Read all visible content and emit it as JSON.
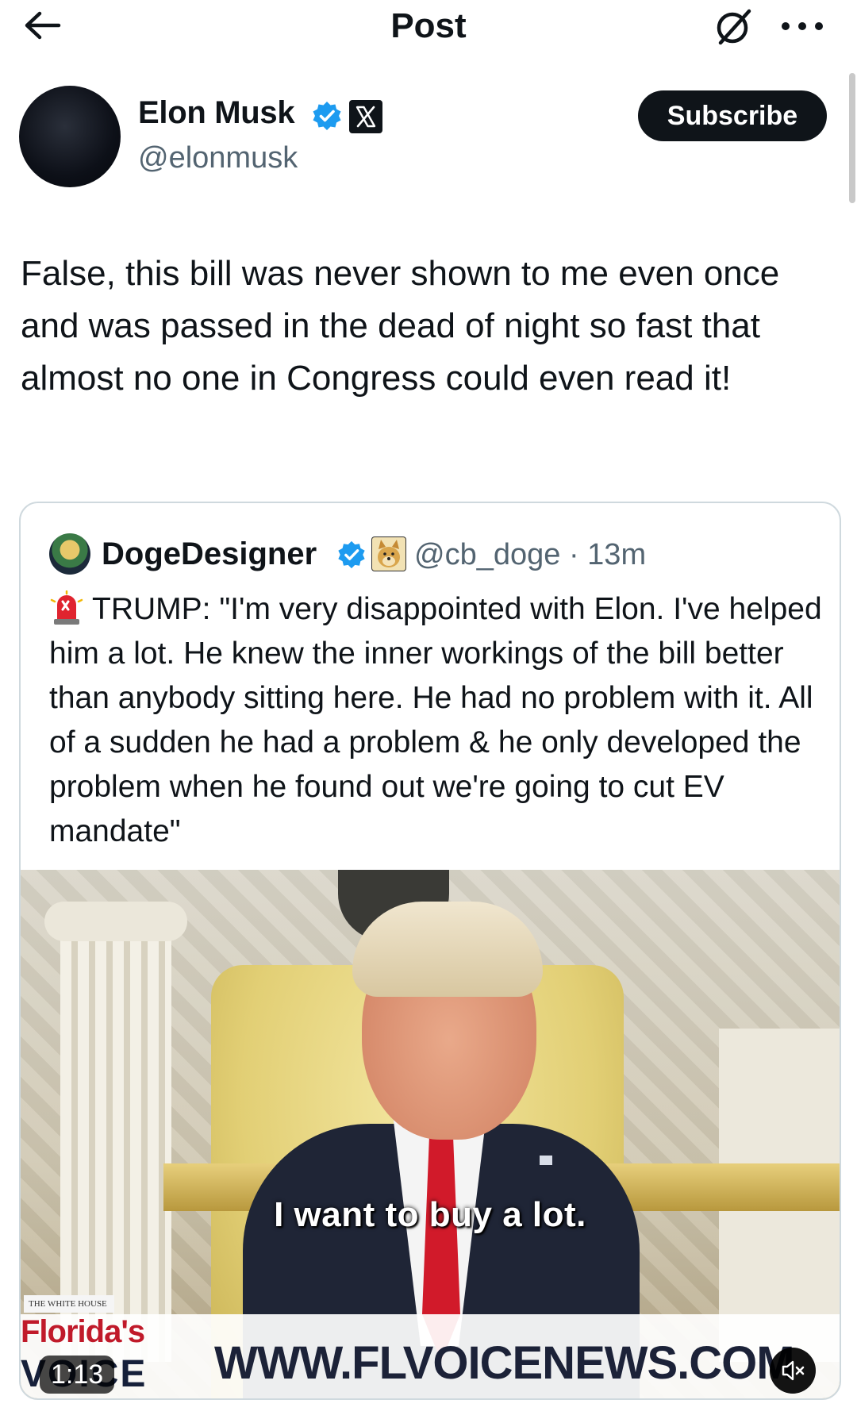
{
  "header": {
    "title": "Post",
    "back_icon": "arrow-left-icon",
    "grok_icon": "grok-icon",
    "more_icon": "more-horizontal-icon"
  },
  "author": {
    "name": "Elon Musk",
    "handle": "@elonmusk",
    "verified": true,
    "affiliation_badge": "x-logo",
    "subscribe_label": "Subscribe"
  },
  "post": {
    "text": "False, this bill was never shown to me even once and was passed in the dead of night so fast that almost no one in Congress could even read it!"
  },
  "quoted_post": {
    "name": "DogeDesigner",
    "handle": "@cb_doge",
    "separator": "·",
    "time": "13m",
    "verified": true,
    "text": "TRUMP: \"I'm very disappointed with Elon. I've helped him a lot. He knew the inner workings of the bill better than anybody sitting here. He had no problem with it. All of a sudden he had a problem & he only developed the problem when he found out we're going to cut EV mandate\"",
    "video": {
      "caption": "I want to buy a lot.",
      "watermark_small": "THE WHITE HOUSE",
      "logo_line1": "Florida's",
      "logo_line2": "VOICE",
      "url": "WWW.FLVOICENEWS.COM",
      "duration": "1:13",
      "muted": true
    }
  },
  "colors": {
    "text_primary": "#0f1419",
    "text_secondary": "#536471",
    "verified_blue": "#1d9bf0",
    "border": "#cfd9de"
  }
}
